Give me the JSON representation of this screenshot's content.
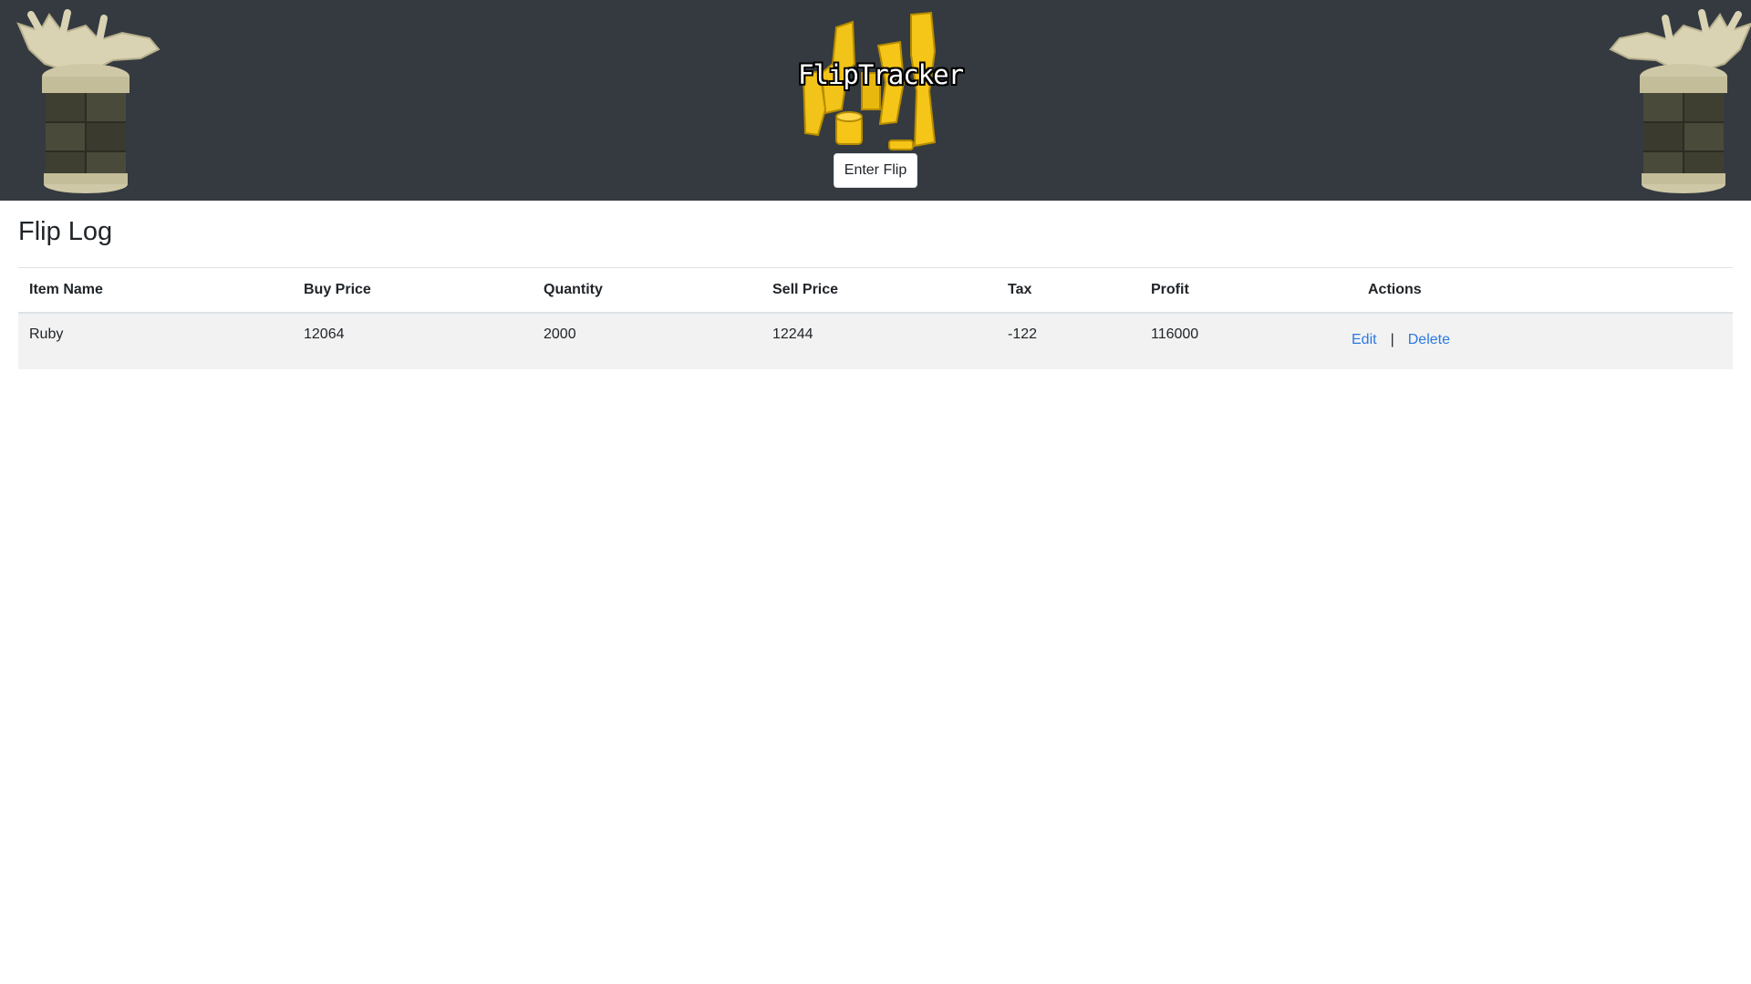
{
  "header": {
    "logo_text": "FlipTracker",
    "enter_flip_label": "Enter Flip"
  },
  "page": {
    "title": "Flip Log"
  },
  "table": {
    "columns": [
      "Item Name",
      "Buy Price",
      "Quantity",
      "Sell Price",
      "Tax",
      "Profit",
      "Actions"
    ],
    "rows": [
      {
        "item_name": "Ruby",
        "buy_price": "12064",
        "quantity": "2000",
        "sell_price": "12244",
        "tax": "-122",
        "profit": "116000",
        "edit_label": "Edit",
        "separator": "|",
        "delete_label": "Delete"
      }
    ]
  },
  "colors": {
    "header_bg": "#343a40",
    "link": "#2a7ae2",
    "row_bg": "#f2f2f2",
    "coin_gold": "#f5c518"
  }
}
